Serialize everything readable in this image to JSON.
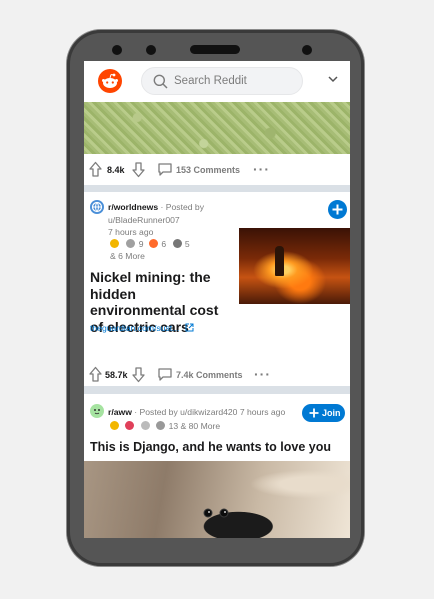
{
  "header": {
    "search_placeholder": "Search Reddit",
    "brand_color": "#ff4500",
    "accent_color": "#0079d3"
  },
  "posts": [
    {
      "votes": "8.4k",
      "comments": "153 Comments"
    },
    {
      "subreddit": "r/worldnews",
      "posted_by": "· Posted by",
      "user": "u/BladeRunner007",
      "time": "7 hours ago",
      "awards": [
        {
          "icon": "award-icon",
          "count": ""
        },
        {
          "icon": "award-icon",
          "count": "9"
        },
        {
          "icon": "award-icon",
          "count": "6"
        },
        {
          "icon": "award-icon",
          "count": "5"
        }
      ],
      "more_awards": "& 6 More",
      "title": "Nickel mining: the hidden environmental cost of electric cars",
      "link": "theguardian.com/sust...",
      "votes": "58.7k",
      "comments": "7.4k Comments"
    },
    {
      "subreddit": "r/aww",
      "byline": "· Posted by u/dikwizard420 7 hours ago",
      "awards_text": "13 & 80 More",
      "join_label": "Join",
      "title": "This is Django, and he wants to love you"
    }
  ]
}
